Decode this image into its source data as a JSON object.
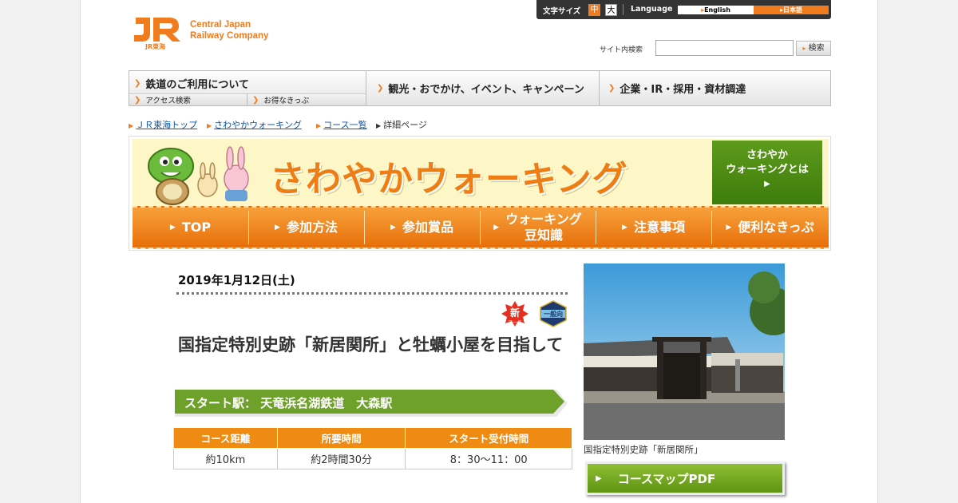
{
  "header": {
    "logo_mark": "JR東海",
    "logo_line1": "Central Japan",
    "logo_line2": "Railway Company",
    "font_size_label": "文字サイズ",
    "font_size_medium": "中",
    "font_size_large": "大",
    "language_label": "Language",
    "lang_english": "English",
    "lang_japanese": "日本語",
    "search_label": "サイト内検索",
    "search_placeholder": "",
    "search_button": "検索"
  },
  "global_nav": {
    "railway": "鉄道のご利用について",
    "railway_sub1": "アクセス検索",
    "railway_sub2": "お得なきっぷ",
    "tourism": "観光・おでかけ、イベント、キャンペーン",
    "corporate": "企業・IR・採用・資材調達"
  },
  "breadcrumb": {
    "item1": "ＪＲ東海トップ",
    "item2": "さわやかウォーキング",
    "item3": "コース一覧",
    "item4": "詳細ページ"
  },
  "banner": {
    "title": "さわやかウォーキング",
    "about_line1": "さわやか",
    "about_line2": "ウォーキングとは",
    "nav": [
      {
        "label": "TOP"
      },
      {
        "label": "参加方法"
      },
      {
        "label": "参加賞品"
      },
      {
        "label": "ウォーキング豆知識",
        "line1": "ウォーキング",
        "line2": "豆知識"
      },
      {
        "label": "注意事項"
      },
      {
        "label": "便利なきっぷ"
      }
    ]
  },
  "course": {
    "date": "2019年1月12日(土)",
    "badge_new": "新",
    "badge_new_sub": "コース",
    "badge_general": "一般向",
    "title": "国指定特別史跡「新居関所」と牡蠣小屋を目指して",
    "start_station": "スタート駅：  天竜浜名湖鉄道　大森駅",
    "table_headers": [
      "コース距離",
      "所要時間",
      "スタート受付時間"
    ],
    "table_values": [
      "約10km",
      "約2時間30分",
      "8：30～11：00"
    ],
    "photo_caption": "国指定特別史跡「新居関所」",
    "pdf_button": "コースマップPDF"
  },
  "colors": {
    "accent_orange": "#ee7d15",
    "accent_green": "#5e9412",
    "link_blue": "#1155aa"
  }
}
